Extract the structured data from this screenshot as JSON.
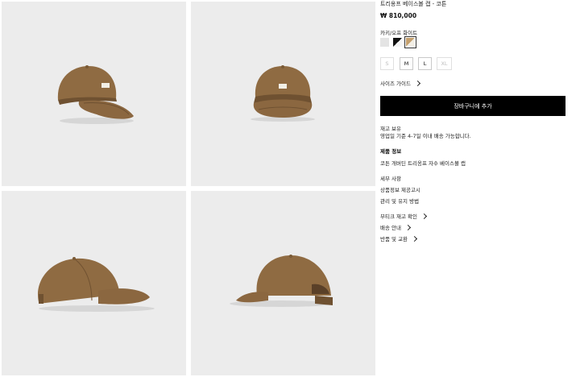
{
  "product": {
    "title": "트리옹프 베이스볼 캡 - 코튼",
    "price": "₩ 810,000",
    "color_label": "카키/오프 화이트",
    "cap_color": "#8f6b42",
    "cap_shadow": "#6f5131"
  },
  "swatches": [
    {
      "name": "light-grey",
      "color": "#e4e4e4"
    },
    {
      "name": "black-white",
      "color": "#111111"
    },
    {
      "name": "khaki-offwhite",
      "color": "#c4a06e",
      "selected": true
    }
  ],
  "sizes": [
    {
      "label": "S",
      "available": false
    },
    {
      "label": "M",
      "available": true
    },
    {
      "label": "L",
      "available": true
    },
    {
      "label": "XL",
      "available": false
    }
  ],
  "size_guide": "사이즈 가이드",
  "add_to_cart": "장바구니에 추가",
  "stock": {
    "status": "재고 보유",
    "delivery": "영업일 기준 4-7일 이내 배송 가능합니다."
  },
  "info": {
    "heading": "제품 정보",
    "description": "코튼 개버딘 트리옹프 자수 베이스볼 캡",
    "details": [
      "세부 사항",
      "상품정보 제공고시",
      "관리 및 유지 방법"
    ]
  },
  "extra_links": [
    "부티크 재고 확인",
    "배송 안내",
    "반품 및 교환"
  ]
}
